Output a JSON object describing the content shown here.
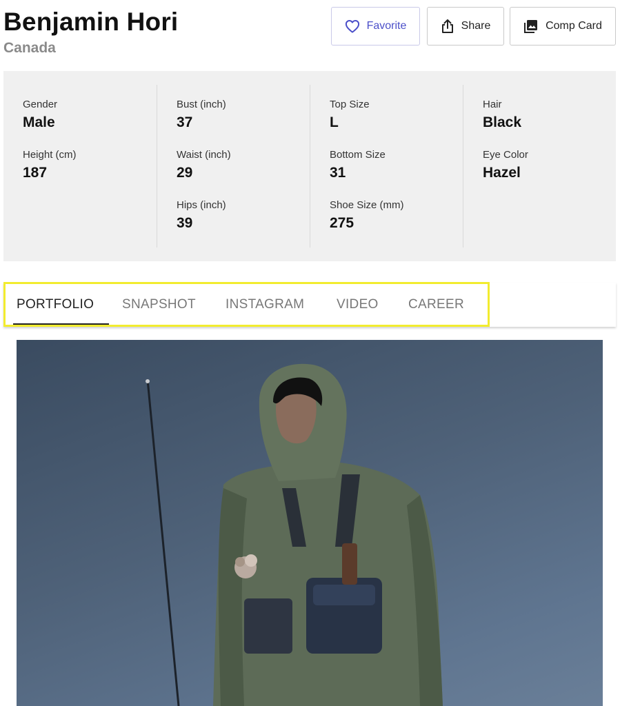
{
  "profile": {
    "name": "Benjamin Hori",
    "country": "Canada"
  },
  "actions": {
    "favorite": "Favorite",
    "share": "Share",
    "comp_card": "Comp Card"
  },
  "stats": {
    "gender": {
      "label": "Gender",
      "value": "Male"
    },
    "height": {
      "label": "Height (cm)",
      "value": "187"
    },
    "bust": {
      "label": "Bust (inch)",
      "value": "37"
    },
    "waist": {
      "label": "Waist (inch)",
      "value": "29"
    },
    "hips": {
      "label": "Hips (inch)",
      "value": "39"
    },
    "top_size": {
      "label": "Top Size",
      "value": "L"
    },
    "bottom_size": {
      "label": "Bottom Size",
      "value": "31"
    },
    "shoe_size": {
      "label": "Shoe Size (mm)",
      "value": "275"
    },
    "hair": {
      "label": "Hair",
      "value": "Black"
    },
    "eye_color": {
      "label": "Eye Color",
      "value": "Hazel"
    }
  },
  "tabs": [
    {
      "label": "PORTFOLIO",
      "active": true
    },
    {
      "label": "SNAPSHOT",
      "active": false
    },
    {
      "label": "INSTAGRAM",
      "active": false
    },
    {
      "label": "VIDEO",
      "active": false
    },
    {
      "label": "CAREER",
      "active": false
    }
  ],
  "colors": {
    "accent": "#4b4fc9",
    "highlight": "#f2ec2e",
    "stats_background": "#f0f0f0"
  },
  "icons": {
    "favorite": "heart-icon",
    "share": "share-icon",
    "comp_card": "image-gallery-icon"
  }
}
